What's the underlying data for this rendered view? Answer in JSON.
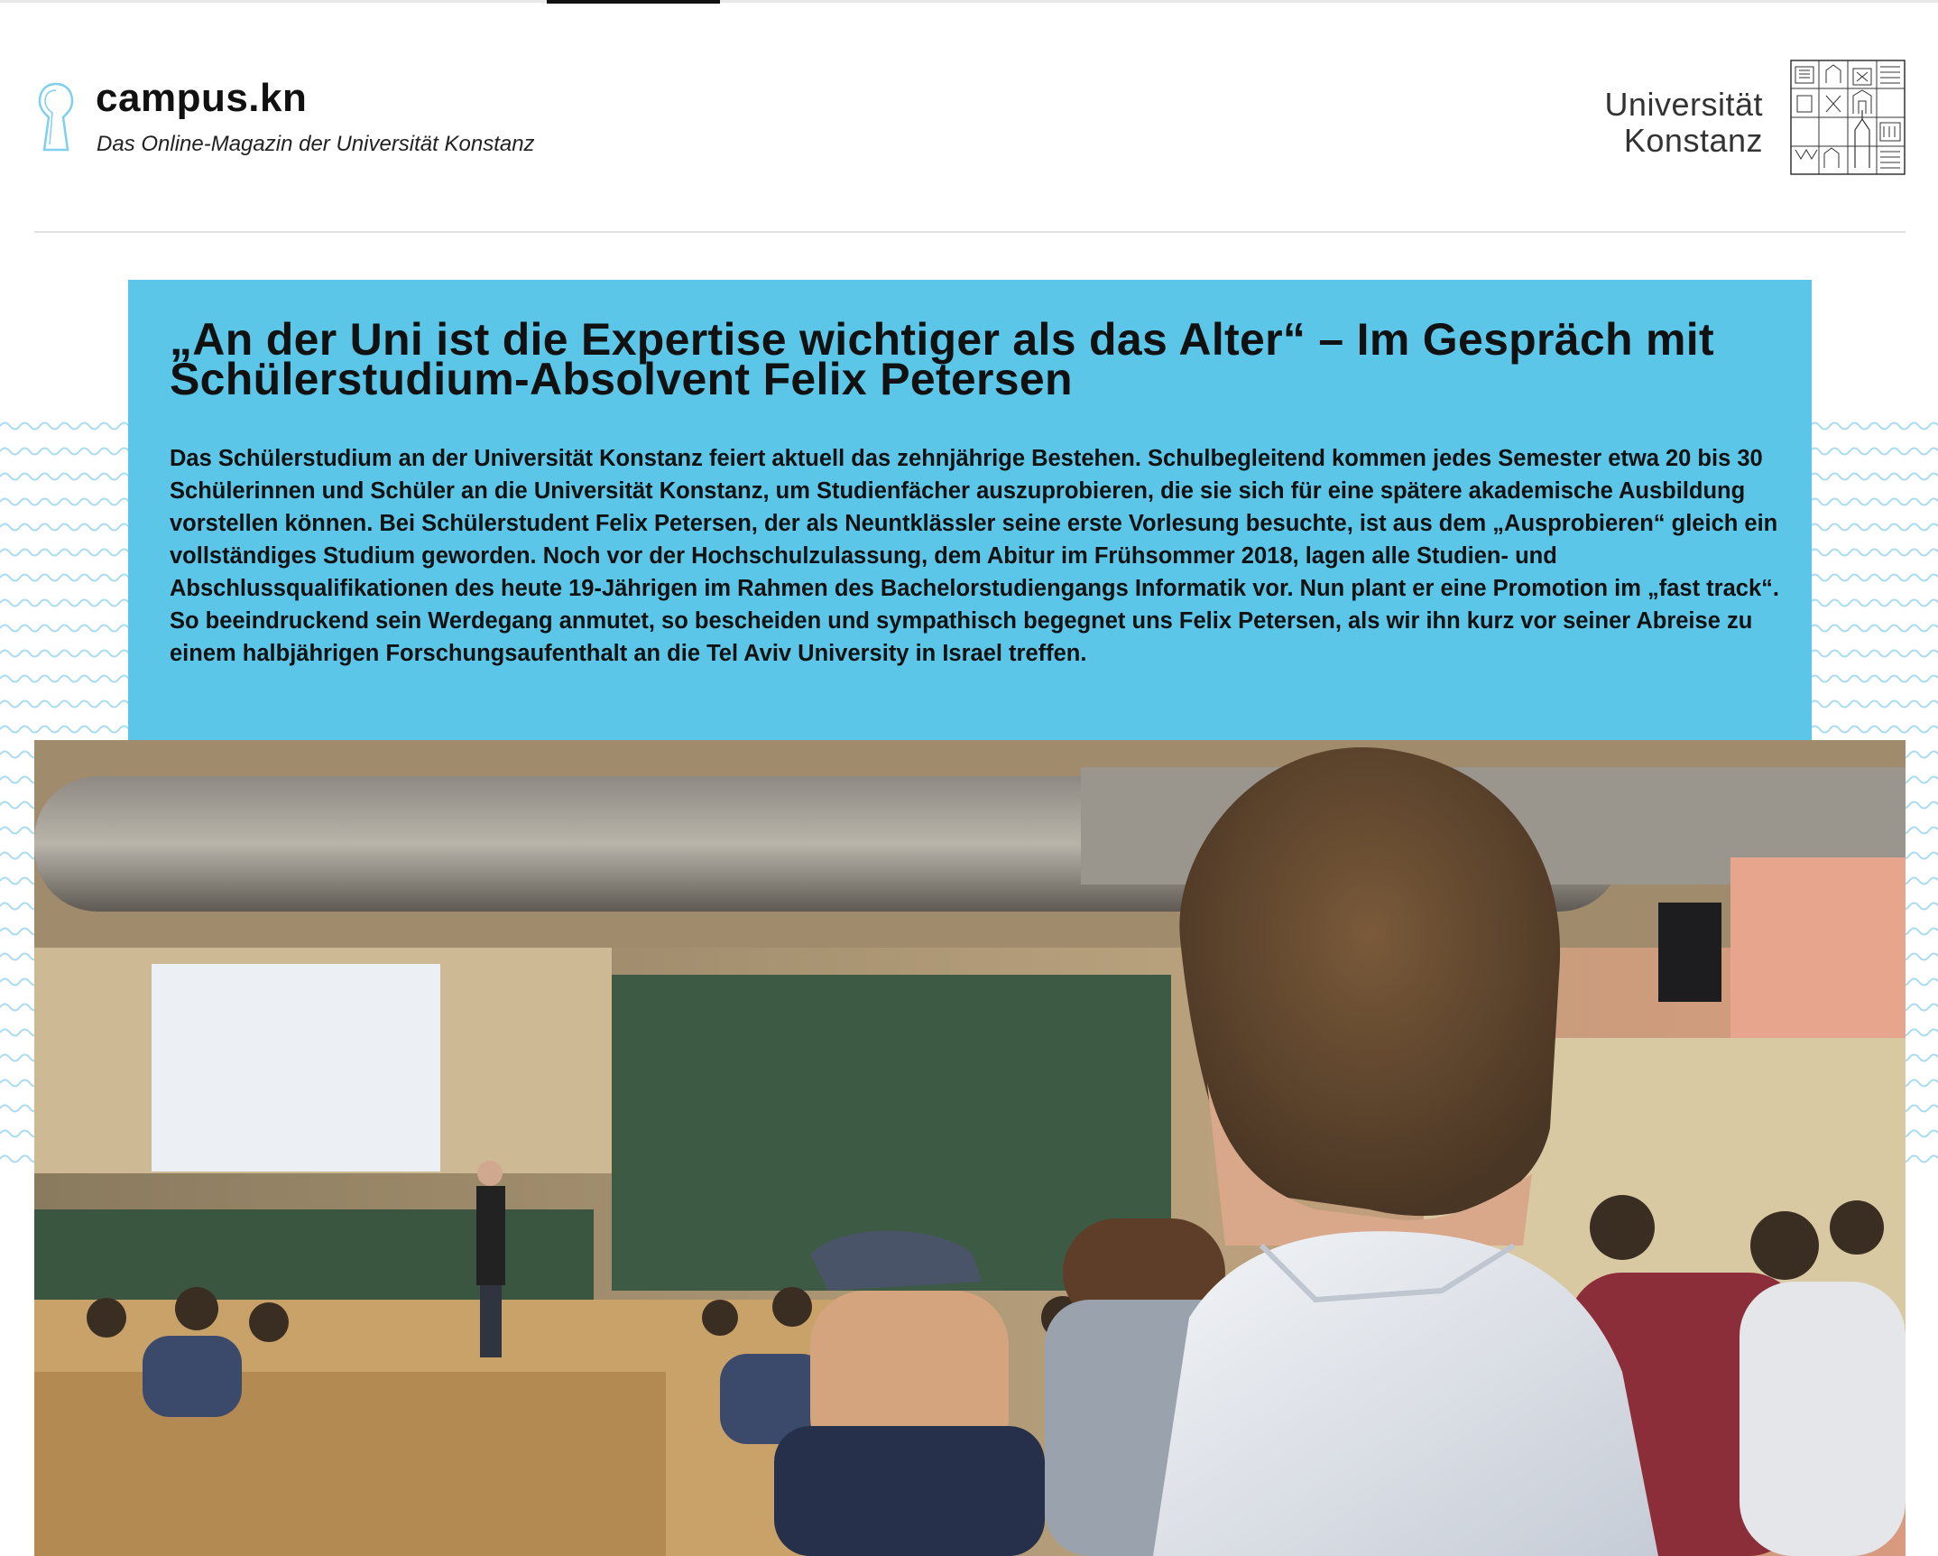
{
  "site": {
    "brand_title": "campus.kn",
    "tagline": "Das Online-Magazin der Universität Konstanz",
    "logo_icon": "keyhole-icon"
  },
  "university": {
    "name_line1": "Universität",
    "name_line2": "Konstanz",
    "emblem_icon": "university-emblem-icon"
  },
  "article": {
    "headline": "„An der Uni ist die Expertise wichtiger als das Alter“ – Im Gespräch mit Schülerstudium-Absolvent Felix Petersen",
    "lead": "Das Schülerstudium an der Universität Konstanz feiert aktuell das zehnjährige Bestehen. Schulbegleitend kommen jedes Semester etwa 20 bis 30 Schülerinnen und Schüler an die Universität Konstanz, um Studienfächer auszuprobieren, die sie sich für eine spätere akademische Ausbildung vorstellen können. Bei Schülerstudent Felix Petersen, der als Neuntklässler seine erste Vorlesung besuchte, ist aus dem „Ausprobieren“ gleich ein vollständiges Studium geworden. Noch vor der Hochschulzulassung, dem Abitur im Frühsommer 2018, lagen alle Studien- und Abschlussqualifikationen des heute 19-Jährigen im Rahmen des Bachelorstudiengangs Informatik vor. Nun plant er eine Promotion im „fast track“. So beeindruckend sein Werdegang anmutet, so bescheiden und sympathisch begegnet uns Felix Petersen, als wir ihn kurz vor seiner Abreise zu einem halbjährigen Forschungsaufenthalt an die Tel Aviv University in Israel treffen."
  },
  "colors": {
    "accent_blue": "#5cc6e8",
    "wave_blue": "#a9dcef"
  }
}
